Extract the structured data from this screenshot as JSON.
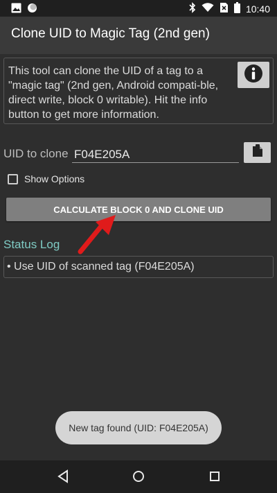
{
  "status_bar": {
    "time": "10:40",
    "left_icons": [
      "image-icon",
      "circle-icon"
    ],
    "right_icons": [
      "bluetooth-icon",
      "wifi-icon",
      "no-sim-icon",
      "battery-icon"
    ]
  },
  "app_bar": {
    "title": "Clone UID to Magic Tag (2nd gen)"
  },
  "info_box": {
    "text": "This tool can clone the UID of a tag to a \"magic tag\" (2nd gen, Android compati-ble, direct write, block 0 writable). Hit the info button to get more information.",
    "button_icon": "info-icon"
  },
  "uid_field": {
    "label": "UID to clone",
    "value": "F04E205A",
    "paste_icon": "paste-icon"
  },
  "options": {
    "show_options_label": "Show Options",
    "checked": false
  },
  "main_button": {
    "label": "CALCULATE BLOCK 0 AND CLONE UID"
  },
  "status_log": {
    "title": "Status Log",
    "entries": [
      "• Use UID of scanned tag (F04E205A)"
    ]
  },
  "toast": {
    "text": "New tag found (UID: F04E205A)"
  },
  "nav_bar": {
    "icons": [
      "back-icon",
      "home-icon",
      "recents-icon"
    ]
  },
  "colors": {
    "background": "#2e2e2e",
    "app_bar": "#3a3a3a",
    "accent_teal": "#7fcbc4",
    "button": "#7f7f7f",
    "arrow_red": "#e01b1b"
  }
}
